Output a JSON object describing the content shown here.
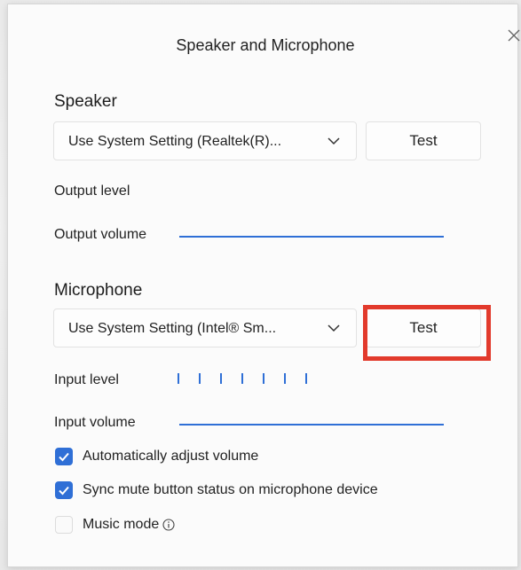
{
  "dialog": {
    "title": "Speaker and Microphone"
  },
  "speaker": {
    "heading": "Speaker",
    "device": "Use System Setting (Realtek(R)...",
    "test_label": "Test",
    "output_level_label": "Output level",
    "output_volume_label": "Output volume",
    "output_volume": 1.0
  },
  "microphone": {
    "heading": "Microphone",
    "device": "Use System Setting (Intel® Sm...",
    "test_label": "Test",
    "input_level_label": "Input level",
    "input_volume_label": "Input volume",
    "input_volume": 1.0
  },
  "options": {
    "auto_adjust": {
      "label": "Automatically adjust volume",
      "checked": true
    },
    "sync_mute": {
      "label": "Sync mute button status on microphone device",
      "checked": true
    },
    "music_mode": {
      "label": "Music mode",
      "checked": false
    }
  },
  "icons": {
    "close": "close-icon",
    "dropdown": "chevron-down-icon",
    "check": "checkmark-icon",
    "info": "info-icon"
  },
  "colors": {
    "accent": "#2f6fd6",
    "highlight": "#e23a2c"
  }
}
